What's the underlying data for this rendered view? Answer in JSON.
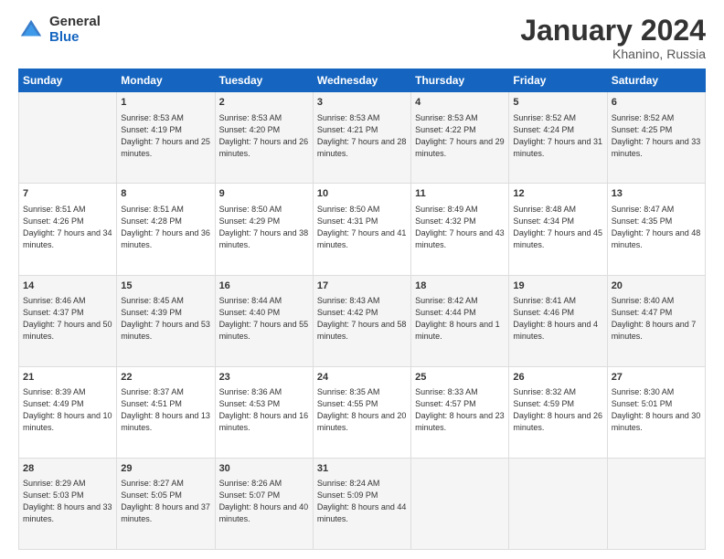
{
  "header": {
    "logo_general": "General",
    "logo_blue": "Blue",
    "month_title": "January 2024",
    "location": "Khanino, Russia"
  },
  "days_of_week": [
    "Sunday",
    "Monday",
    "Tuesday",
    "Wednesday",
    "Thursday",
    "Friday",
    "Saturday"
  ],
  "weeks": [
    [
      {
        "day": "",
        "sunrise": "",
        "sunset": "",
        "daylight": ""
      },
      {
        "day": "1",
        "sunrise": "Sunrise: 8:53 AM",
        "sunset": "Sunset: 4:19 PM",
        "daylight": "Daylight: 7 hours and 25 minutes."
      },
      {
        "day": "2",
        "sunrise": "Sunrise: 8:53 AM",
        "sunset": "Sunset: 4:20 PM",
        "daylight": "Daylight: 7 hours and 26 minutes."
      },
      {
        "day": "3",
        "sunrise": "Sunrise: 8:53 AM",
        "sunset": "Sunset: 4:21 PM",
        "daylight": "Daylight: 7 hours and 28 minutes."
      },
      {
        "day": "4",
        "sunrise": "Sunrise: 8:53 AM",
        "sunset": "Sunset: 4:22 PM",
        "daylight": "Daylight: 7 hours and 29 minutes."
      },
      {
        "day": "5",
        "sunrise": "Sunrise: 8:52 AM",
        "sunset": "Sunset: 4:24 PM",
        "daylight": "Daylight: 7 hours and 31 minutes."
      },
      {
        "day": "6",
        "sunrise": "Sunrise: 8:52 AM",
        "sunset": "Sunset: 4:25 PM",
        "daylight": "Daylight: 7 hours and 33 minutes."
      }
    ],
    [
      {
        "day": "7",
        "sunrise": "Sunrise: 8:51 AM",
        "sunset": "Sunset: 4:26 PM",
        "daylight": "Daylight: 7 hours and 34 minutes."
      },
      {
        "day": "8",
        "sunrise": "Sunrise: 8:51 AM",
        "sunset": "Sunset: 4:28 PM",
        "daylight": "Daylight: 7 hours and 36 minutes."
      },
      {
        "day": "9",
        "sunrise": "Sunrise: 8:50 AM",
        "sunset": "Sunset: 4:29 PM",
        "daylight": "Daylight: 7 hours and 38 minutes."
      },
      {
        "day": "10",
        "sunrise": "Sunrise: 8:50 AM",
        "sunset": "Sunset: 4:31 PM",
        "daylight": "Daylight: 7 hours and 41 minutes."
      },
      {
        "day": "11",
        "sunrise": "Sunrise: 8:49 AM",
        "sunset": "Sunset: 4:32 PM",
        "daylight": "Daylight: 7 hours and 43 minutes."
      },
      {
        "day": "12",
        "sunrise": "Sunrise: 8:48 AM",
        "sunset": "Sunset: 4:34 PM",
        "daylight": "Daylight: 7 hours and 45 minutes."
      },
      {
        "day": "13",
        "sunrise": "Sunrise: 8:47 AM",
        "sunset": "Sunset: 4:35 PM",
        "daylight": "Daylight: 7 hours and 48 minutes."
      }
    ],
    [
      {
        "day": "14",
        "sunrise": "Sunrise: 8:46 AM",
        "sunset": "Sunset: 4:37 PM",
        "daylight": "Daylight: 7 hours and 50 minutes."
      },
      {
        "day": "15",
        "sunrise": "Sunrise: 8:45 AM",
        "sunset": "Sunset: 4:39 PM",
        "daylight": "Daylight: 7 hours and 53 minutes."
      },
      {
        "day": "16",
        "sunrise": "Sunrise: 8:44 AM",
        "sunset": "Sunset: 4:40 PM",
        "daylight": "Daylight: 7 hours and 55 minutes."
      },
      {
        "day": "17",
        "sunrise": "Sunrise: 8:43 AM",
        "sunset": "Sunset: 4:42 PM",
        "daylight": "Daylight: 7 hours and 58 minutes."
      },
      {
        "day": "18",
        "sunrise": "Sunrise: 8:42 AM",
        "sunset": "Sunset: 4:44 PM",
        "daylight": "Daylight: 8 hours and 1 minute."
      },
      {
        "day": "19",
        "sunrise": "Sunrise: 8:41 AM",
        "sunset": "Sunset: 4:46 PM",
        "daylight": "Daylight: 8 hours and 4 minutes."
      },
      {
        "day": "20",
        "sunrise": "Sunrise: 8:40 AM",
        "sunset": "Sunset: 4:47 PM",
        "daylight": "Daylight: 8 hours and 7 minutes."
      }
    ],
    [
      {
        "day": "21",
        "sunrise": "Sunrise: 8:39 AM",
        "sunset": "Sunset: 4:49 PM",
        "daylight": "Daylight: 8 hours and 10 minutes."
      },
      {
        "day": "22",
        "sunrise": "Sunrise: 8:37 AM",
        "sunset": "Sunset: 4:51 PM",
        "daylight": "Daylight: 8 hours and 13 minutes."
      },
      {
        "day": "23",
        "sunrise": "Sunrise: 8:36 AM",
        "sunset": "Sunset: 4:53 PM",
        "daylight": "Daylight: 8 hours and 16 minutes."
      },
      {
        "day": "24",
        "sunrise": "Sunrise: 8:35 AM",
        "sunset": "Sunset: 4:55 PM",
        "daylight": "Daylight: 8 hours and 20 minutes."
      },
      {
        "day": "25",
        "sunrise": "Sunrise: 8:33 AM",
        "sunset": "Sunset: 4:57 PM",
        "daylight": "Daylight: 8 hours and 23 minutes."
      },
      {
        "day": "26",
        "sunrise": "Sunrise: 8:32 AM",
        "sunset": "Sunset: 4:59 PM",
        "daylight": "Daylight: 8 hours and 26 minutes."
      },
      {
        "day": "27",
        "sunrise": "Sunrise: 8:30 AM",
        "sunset": "Sunset: 5:01 PM",
        "daylight": "Daylight: 8 hours and 30 minutes."
      }
    ],
    [
      {
        "day": "28",
        "sunrise": "Sunrise: 8:29 AM",
        "sunset": "Sunset: 5:03 PM",
        "daylight": "Daylight: 8 hours and 33 minutes."
      },
      {
        "day": "29",
        "sunrise": "Sunrise: 8:27 AM",
        "sunset": "Sunset: 5:05 PM",
        "daylight": "Daylight: 8 hours and 37 minutes."
      },
      {
        "day": "30",
        "sunrise": "Sunrise: 8:26 AM",
        "sunset": "Sunset: 5:07 PM",
        "daylight": "Daylight: 8 hours and 40 minutes."
      },
      {
        "day": "31",
        "sunrise": "Sunrise: 8:24 AM",
        "sunset": "Sunset: 5:09 PM",
        "daylight": "Daylight: 8 hours and 44 minutes."
      },
      {
        "day": "",
        "sunrise": "",
        "sunset": "",
        "daylight": ""
      },
      {
        "day": "",
        "sunrise": "",
        "sunset": "",
        "daylight": ""
      },
      {
        "day": "",
        "sunrise": "",
        "sunset": "",
        "daylight": ""
      }
    ]
  ]
}
